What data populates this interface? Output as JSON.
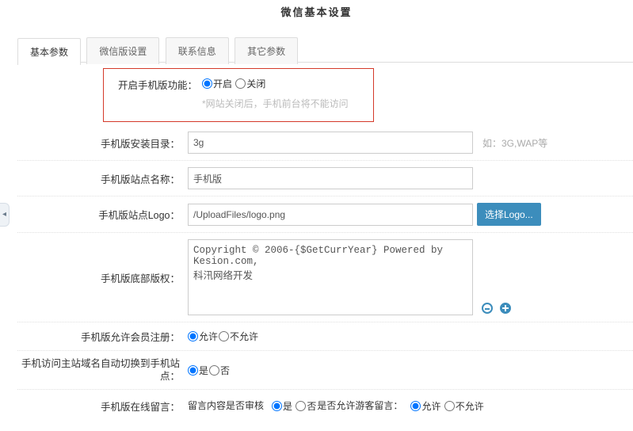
{
  "header": {
    "title": "微信基本设置"
  },
  "tabs": [
    {
      "label": "基本参数",
      "active": true
    },
    {
      "label": "微信版设置",
      "active": false
    },
    {
      "label": "联系信息",
      "active": false
    },
    {
      "label": "其它参数",
      "active": false
    }
  ],
  "mobile_enable": {
    "label": "开启手机版功能：",
    "options": {
      "on": "开启",
      "off": "关闭"
    },
    "selected": "on",
    "hint": "*网站关闭后，手机前台将不能访问"
  },
  "install_dir": {
    "label": "手机版安装目录：",
    "value": "3g",
    "right_hint": "如：3G,WAP等"
  },
  "site_name": {
    "label": "手机版站点名称：",
    "value": "手机版"
  },
  "site_logo": {
    "label": "手机版站点Logo：",
    "value": "/UploadFiles/logo.png",
    "button": "选择Logo..."
  },
  "footer": {
    "label": "手机版底部版权：",
    "value": "Copyright © 2006-{$GetCurrYear} Powered by Kesion.com,\n科汛网络开发",
    "minus_name": "remove-icon",
    "plus_name": "add-icon"
  },
  "allow_reg": {
    "label": "手机版允许会员注册：",
    "options": {
      "yes": "允许",
      "no": "不允许"
    },
    "selected": "yes"
  },
  "auto_switch": {
    "label": "手机访问主站域名自动切换到手机站点：",
    "options": {
      "yes": "是",
      "no": "否"
    },
    "selected": "yes"
  },
  "guestbook": {
    "label": "手机版在线留言：",
    "sub1_label": "留言内容是否审核",
    "sub1_options": {
      "yes": "是",
      "no": "否"
    },
    "sub1_selected": "yes",
    "sub2_label": "是否允许游客留言：",
    "sub2_options": {
      "yes": "允许",
      "no": "不允许"
    },
    "sub2_selected": "yes"
  },
  "left_handle_glyph": "◂"
}
